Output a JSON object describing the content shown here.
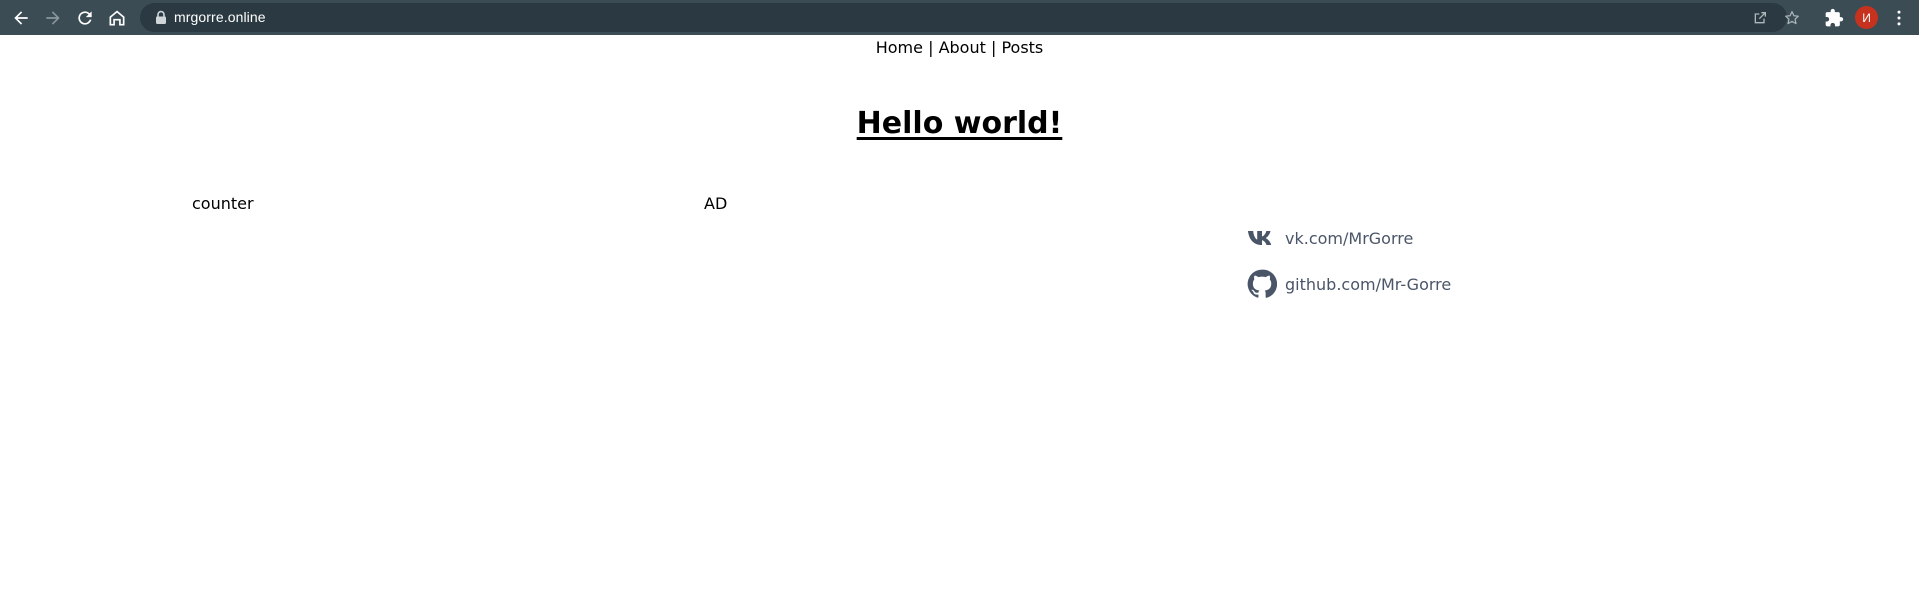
{
  "browser": {
    "url": "mrgorre.online",
    "profile_initial": "И",
    "toolbar_color": "#3c4c55",
    "avatar_color": "#c7321e",
    "icons": [
      "back-arrow-icon",
      "forward-arrow-icon",
      "reload-icon",
      "home-icon",
      "lock-icon",
      "share-icon",
      "star-icon",
      "extensions-icon",
      "menu-icon"
    ]
  },
  "nav": {
    "items": [
      {
        "label": "Home"
      },
      {
        "label": "About"
      },
      {
        "label": "Posts"
      }
    ],
    "separator": "|"
  },
  "page": {
    "title": "Hello world!",
    "counter_label": "counter",
    "ad_label": "AD"
  },
  "social": {
    "text_color": "#4a5568",
    "links": [
      {
        "icon": "vk-icon",
        "label": "vk.com/MrGorre"
      },
      {
        "icon": "github-icon",
        "label": "github.com/Mr-Gorre"
      }
    ]
  }
}
